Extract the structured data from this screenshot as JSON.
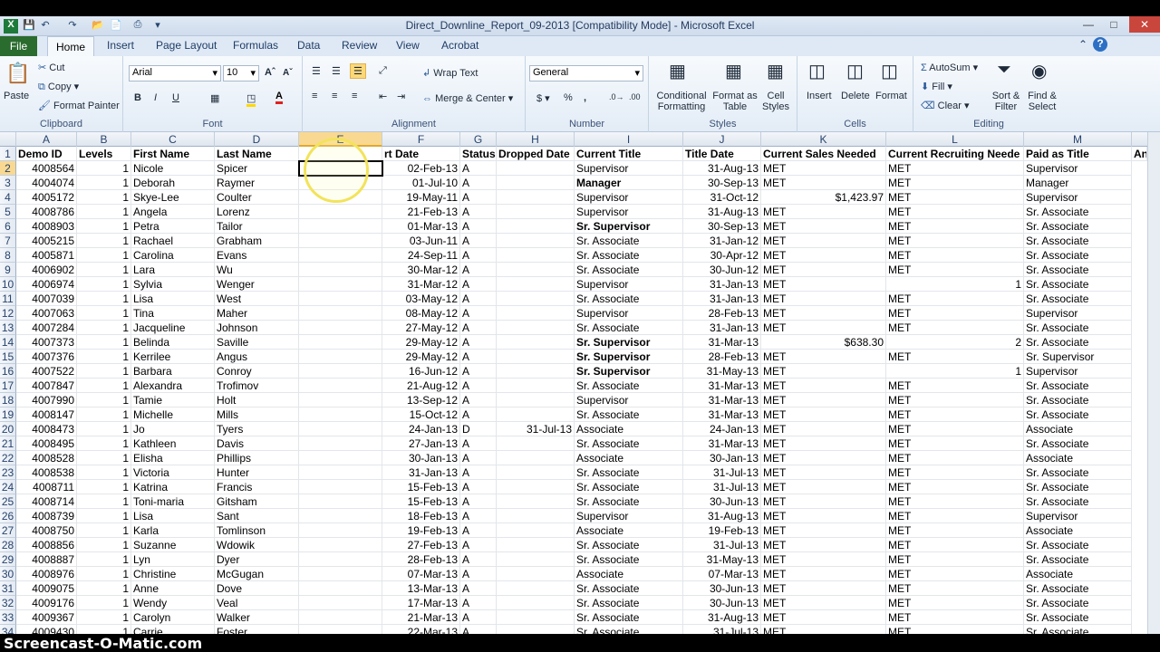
{
  "window": {
    "title": "Direct_Downline_Report_09-2013  [Compatibility Mode]  -  Microsoft Excel"
  },
  "tabs": [
    "File",
    "Home",
    "Insert",
    "Page Layout",
    "Formulas",
    "Data",
    "Review",
    "View",
    "Acrobat"
  ],
  "ribbon": {
    "clipboard": {
      "paste": "Paste",
      "cut": "Cut",
      "copy": "Copy",
      "format_painter": "Format Painter",
      "label": "Clipboard"
    },
    "font": {
      "name": "Arial",
      "size": "10",
      "label": "Font"
    },
    "alignment": {
      "wrap": "Wrap Text",
      "merge": "Merge & Center",
      "label": "Alignment"
    },
    "number": {
      "format": "General",
      "label": "Number"
    },
    "styles": {
      "conditional": "Conditional Formatting",
      "format_table": "Format as Table",
      "cell_styles": "Cell Styles",
      "label": "Styles"
    },
    "cells": {
      "insert": "Insert",
      "delete": "Delete",
      "format": "Format",
      "label": "Cells"
    },
    "editing": {
      "autosum": "AutoSum",
      "fill": "Fill",
      "clear": "Clear",
      "sort": "Sort & Filter",
      "find": "Find & Select",
      "label": "Editing"
    }
  },
  "columns": [
    "A",
    "B",
    "C",
    "D",
    "E",
    "F",
    "G",
    "H",
    "I",
    "J",
    "K",
    "L",
    "M"
  ],
  "headers": [
    "Demo ID",
    "Levels",
    "First Name",
    "Last Name",
    "",
    "rt Date",
    "Status",
    "Dropped Date",
    "Current Title",
    "Title Date",
    "Current Sales Needed",
    "Current Recruiting Neede",
    "Paid as Title",
    "An"
  ],
  "rows": [
    [
      "4008564",
      "1",
      "Nicole",
      "Spicer",
      "",
      "02-Feb-13",
      "A",
      "",
      "Supervisor",
      "31-Aug-13",
      "MET",
      "MET",
      "Supervisor"
    ],
    [
      "4004074",
      "1",
      "Deborah",
      "Raymer",
      "",
      "01-Jul-10",
      "A",
      "",
      "Manager",
      "30-Sep-13",
      "MET",
      "MET",
      "Manager"
    ],
    [
      "4005172",
      "1",
      "Skye-Lee",
      "Coulter",
      "",
      "19-May-11",
      "A",
      "",
      "Supervisor",
      "31-Oct-12",
      "$1,423.97",
      "MET",
      "Supervisor"
    ],
    [
      "4008786",
      "1",
      "Angela",
      "Lorenz",
      "",
      "21-Feb-13",
      "A",
      "",
      "Supervisor",
      "31-Aug-13",
      "MET",
      "MET",
      "Sr. Associate"
    ],
    [
      "4008903",
      "1",
      "Petra",
      "Tailor",
      "",
      "01-Mar-13",
      "A",
      "",
      "Sr. Supervisor",
      "30-Sep-13",
      "MET",
      "MET",
      "Sr. Associate"
    ],
    [
      "4005215",
      "1",
      "Rachael",
      "Grabham",
      "",
      "03-Jun-11",
      "A",
      "",
      "Sr. Associate",
      "31-Jan-12",
      "MET",
      "MET",
      "Sr. Associate"
    ],
    [
      "4005871",
      "1",
      "Carolina",
      "Evans",
      "",
      "24-Sep-11",
      "A",
      "",
      "Sr. Associate",
      "30-Apr-12",
      "MET",
      "MET",
      "Sr. Associate"
    ],
    [
      "4006902",
      "1",
      "Lara",
      "Wu",
      "",
      "30-Mar-12",
      "A",
      "",
      "Sr. Associate",
      "30-Jun-12",
      "MET",
      "MET",
      "Sr. Associate"
    ],
    [
      "4006974",
      "1",
      "Sylvia",
      "Wenger",
      "",
      "31-Mar-12",
      "A",
      "",
      "Supervisor",
      "31-Jan-13",
      "MET",
      "1",
      "Sr. Associate"
    ],
    [
      "4007039",
      "1",
      "Lisa",
      "West",
      "",
      "03-May-12",
      "A",
      "",
      "Sr. Associate",
      "31-Jan-13",
      "MET",
      "MET",
      "Sr. Associate"
    ],
    [
      "4007063",
      "1",
      "Tina",
      "Maher",
      "",
      "08-May-12",
      "A",
      "",
      "Supervisor",
      "28-Feb-13",
      "MET",
      "MET",
      "Supervisor"
    ],
    [
      "4007284",
      "1",
      "Jacqueline",
      "Johnson",
      "",
      "27-May-12",
      "A",
      "",
      "Sr. Associate",
      "31-Jan-13",
      "MET",
      "MET",
      "Sr. Associate"
    ],
    [
      "4007373",
      "1",
      "Belinda",
      "Saville",
      "",
      "29-May-12",
      "A",
      "",
      "Sr. Supervisor",
      "31-Mar-13",
      "$638.30",
      "2",
      "Sr. Associate"
    ],
    [
      "4007376",
      "1",
      "Kerrilee",
      "Angus",
      "",
      "29-May-12",
      "A",
      "",
      "Sr. Supervisor",
      "28-Feb-13",
      "MET",
      "MET",
      "Sr. Supervisor"
    ],
    [
      "4007522",
      "1",
      "Barbara",
      "Conroy",
      "",
      "16-Jun-12",
      "A",
      "",
      "Sr. Supervisor",
      "31-May-13",
      "MET",
      "1",
      "Supervisor"
    ],
    [
      "4007847",
      "1",
      "Alexandra",
      "Trofimov",
      "",
      "21-Aug-12",
      "A",
      "",
      "Sr. Associate",
      "31-Mar-13",
      "MET",
      "MET",
      "Sr. Associate"
    ],
    [
      "4007990",
      "1",
      "Tamie",
      "Holt",
      "",
      "13-Sep-12",
      "A",
      "",
      "Supervisor",
      "31-Mar-13",
      "MET",
      "MET",
      "Sr. Associate"
    ],
    [
      "4008147",
      "1",
      "Michelle",
      "Mills",
      "",
      "15-Oct-12",
      "A",
      "",
      "Sr. Associate",
      "31-Mar-13",
      "MET",
      "MET",
      "Sr. Associate"
    ],
    [
      "4008473",
      "1",
      "Jo",
      "Tyers",
      "",
      "24-Jan-13",
      "D",
      "31-Jul-13",
      "Associate",
      "24-Jan-13",
      "MET",
      "MET",
      "Associate"
    ],
    [
      "4008495",
      "1",
      "Kathleen",
      "Davis",
      "",
      "27-Jan-13",
      "A",
      "",
      "Sr. Associate",
      "31-Mar-13",
      "MET",
      "MET",
      "Sr. Associate"
    ],
    [
      "4008528",
      "1",
      "Elisha",
      "Phillips",
      "",
      "30-Jan-13",
      "A",
      "",
      "Associate",
      "30-Jan-13",
      "MET",
      "MET",
      "Associate"
    ],
    [
      "4008538",
      "1",
      "Victoria",
      "Hunter",
      "",
      "31-Jan-13",
      "A",
      "",
      "Sr. Associate",
      "31-Jul-13",
      "MET",
      "MET",
      "Sr. Associate"
    ],
    [
      "4008711",
      "1",
      "Katrina",
      "Francis",
      "",
      "15-Feb-13",
      "A",
      "",
      "Sr. Associate",
      "31-Jul-13",
      "MET",
      "MET",
      "Sr. Associate"
    ],
    [
      "4008714",
      "1",
      "Toni-maria",
      "Gitsham",
      "",
      "15-Feb-13",
      "A",
      "",
      "Sr. Associate",
      "30-Jun-13",
      "MET",
      "MET",
      "Sr. Associate"
    ],
    [
      "4008739",
      "1",
      "Lisa",
      "Sant",
      "",
      "18-Feb-13",
      "A",
      "",
      "Supervisor",
      "31-Aug-13",
      "MET",
      "MET",
      "Supervisor"
    ],
    [
      "4008750",
      "1",
      "Karla",
      "Tomlinson",
      "",
      "19-Feb-13",
      "A",
      "",
      "Associate",
      "19-Feb-13",
      "MET",
      "MET",
      "Associate"
    ],
    [
      "4008856",
      "1",
      "Suzanne",
      "Wdowik",
      "",
      "27-Feb-13",
      "A",
      "",
      "Sr. Associate",
      "31-Jul-13",
      "MET",
      "MET",
      "Sr. Associate"
    ],
    [
      "4008887",
      "1",
      "Lyn",
      "Dyer",
      "",
      "28-Feb-13",
      "A",
      "",
      "Sr. Associate",
      "31-May-13",
      "MET",
      "MET",
      "Sr. Associate"
    ],
    [
      "4008976",
      "1",
      "Christine",
      "McGugan",
      "",
      "07-Mar-13",
      "A",
      "",
      "Associate",
      "07-Mar-13",
      "MET",
      "MET",
      "Associate"
    ],
    [
      "4009075",
      "1",
      "Anne",
      "Dove",
      "",
      "13-Mar-13",
      "A",
      "",
      "Sr. Associate",
      "30-Jun-13",
      "MET",
      "MET",
      "Sr. Associate"
    ],
    [
      "4009176",
      "1",
      "Wendy",
      "Veal",
      "",
      "17-Mar-13",
      "A",
      "",
      "Sr. Associate",
      "30-Jun-13",
      "MET",
      "MET",
      "Sr. Associate"
    ],
    [
      "4009367",
      "1",
      "Carolyn",
      "Walker",
      "",
      "21-Mar-13",
      "A",
      "",
      "Sr. Associate",
      "31-Aug-13",
      "MET",
      "MET",
      "Sr. Associate"
    ],
    [
      "4009430",
      "1",
      "Carrie",
      "Foster",
      "",
      "22-Mar-13",
      "A",
      "",
      "Sr. Associate",
      "31-Jul-13",
      "MET",
      "MET",
      "Sr. Associate"
    ]
  ],
  "bold_titles": [
    "Manager",
    "Sr. Supervisor"
  ],
  "watermark": "Screencast-O-Matic.com"
}
